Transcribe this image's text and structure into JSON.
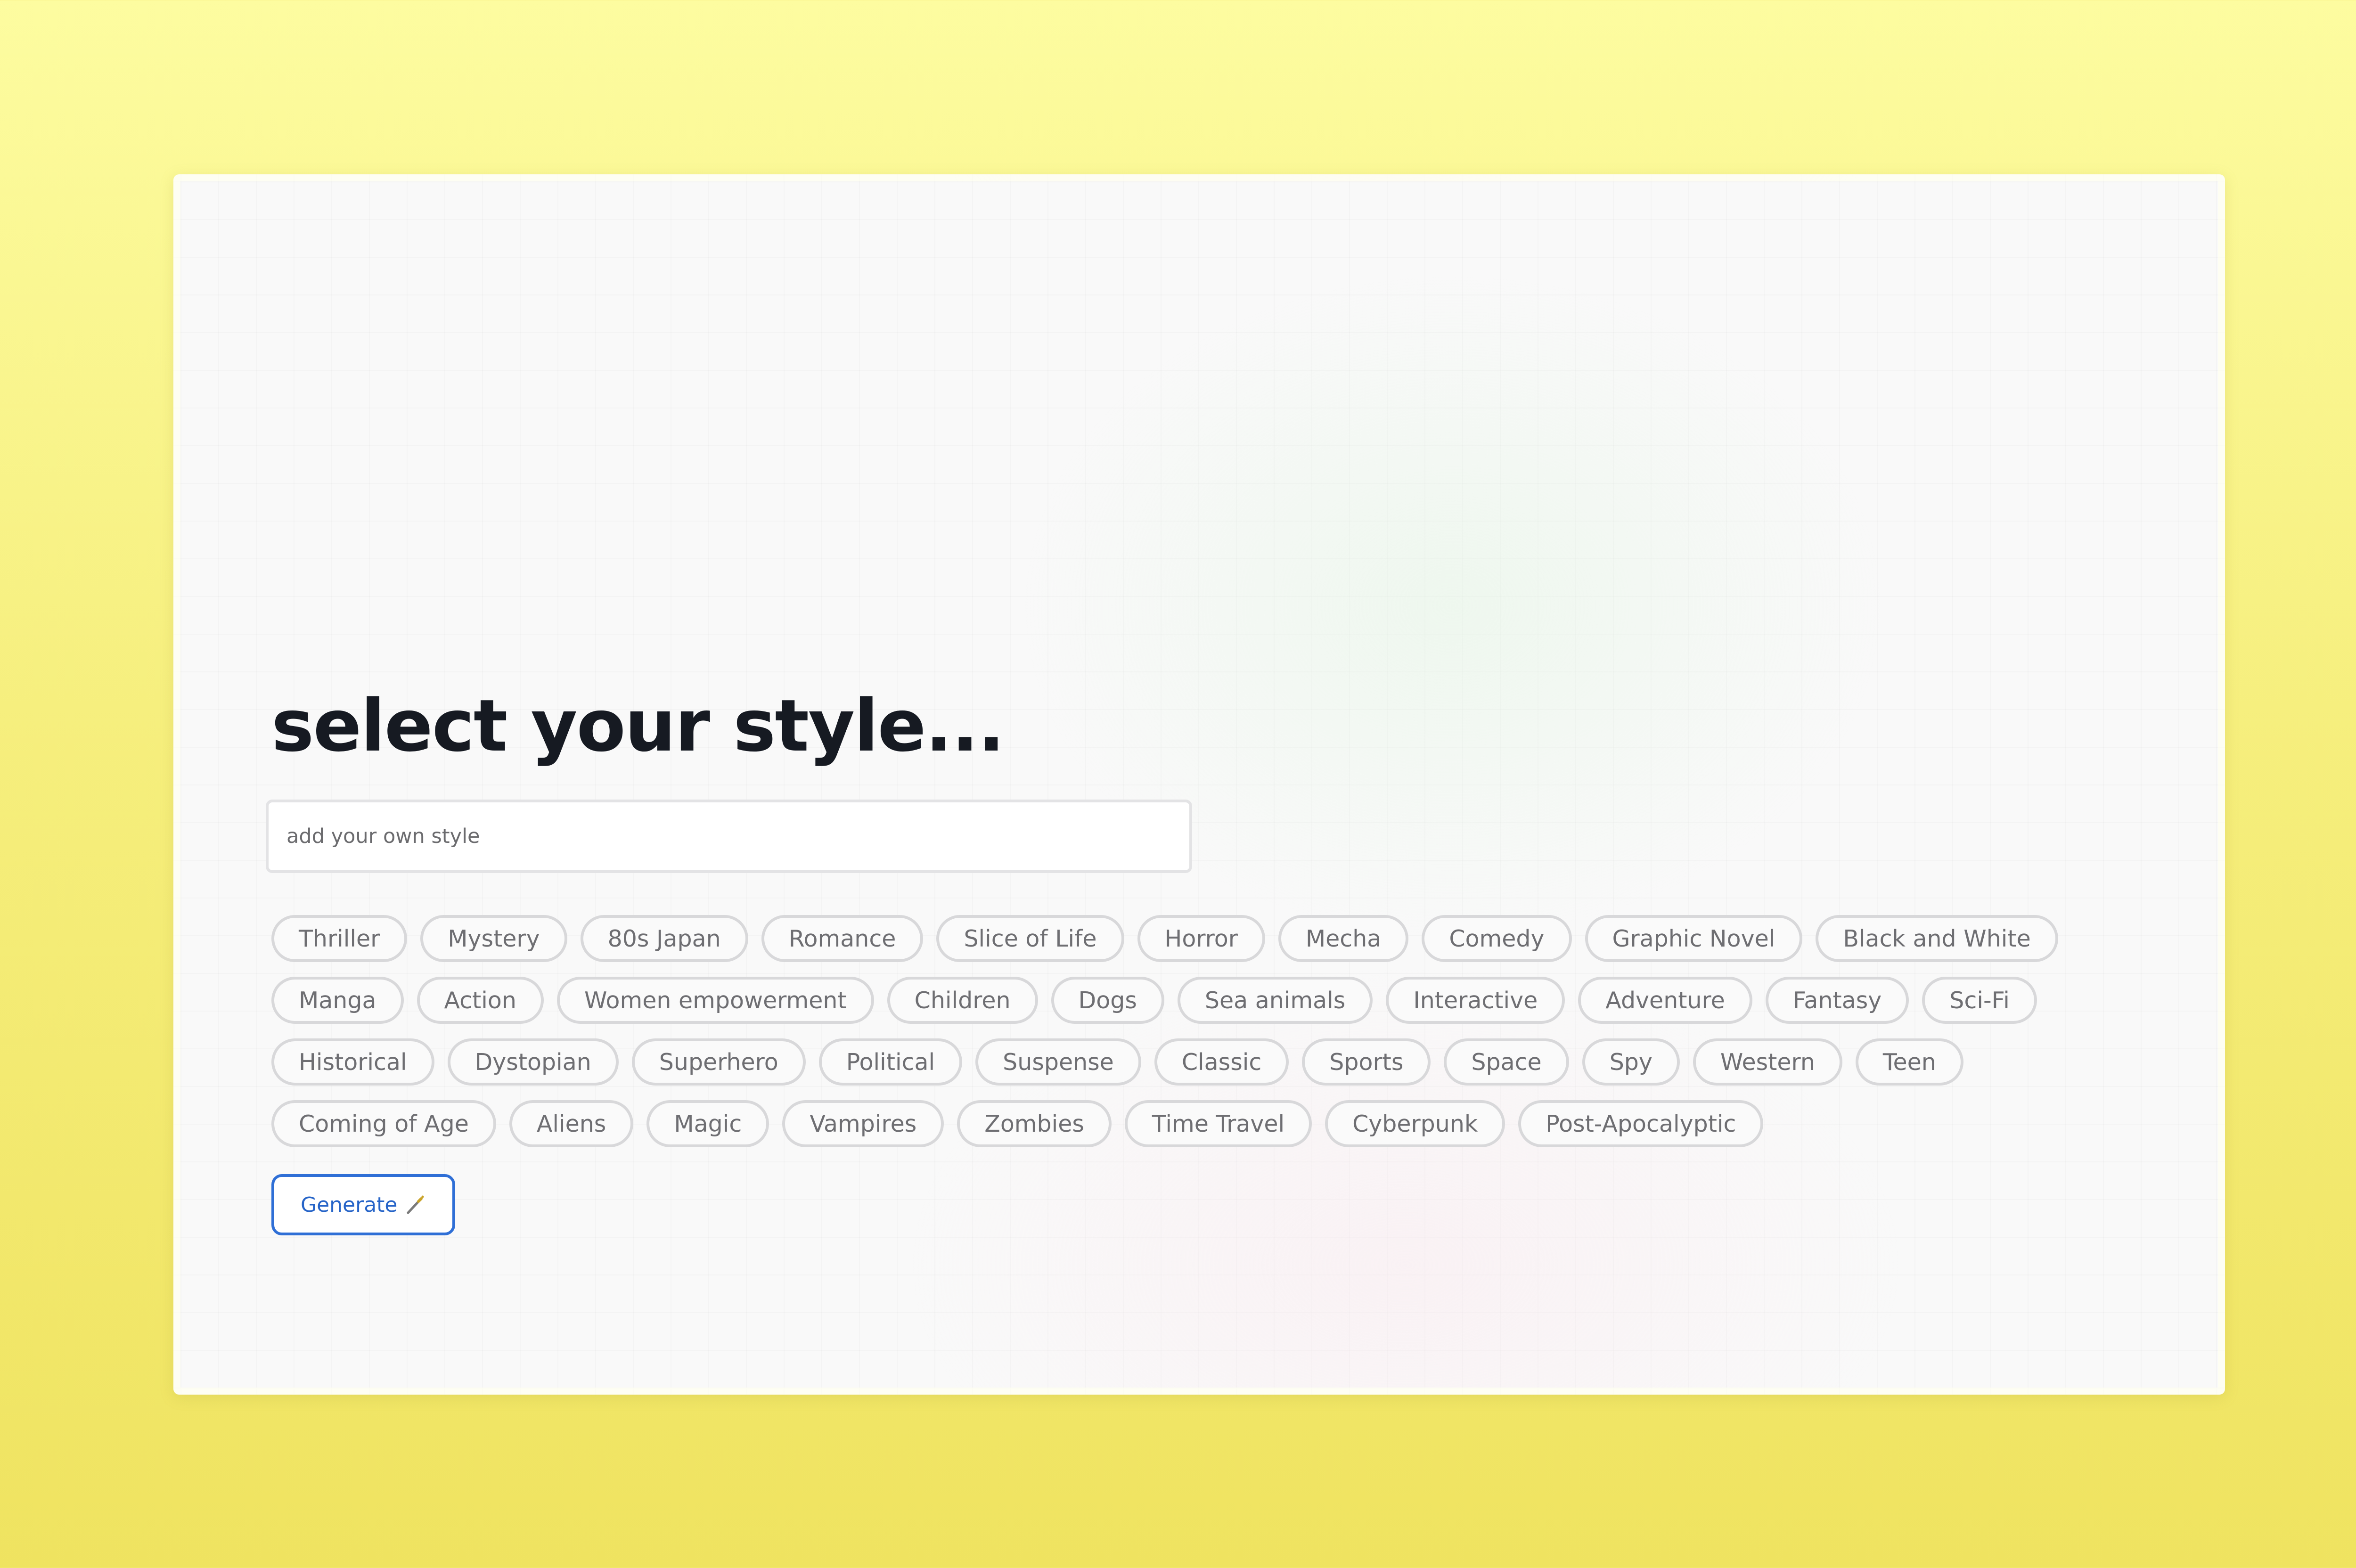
{
  "page": {
    "title": "select your style..."
  },
  "style_input": {
    "placeholder": "add your own style",
    "value": ""
  },
  "styles": {
    "rows": [
      [
        "Thriller",
        "Mystery",
        "80s Japan",
        "Romance",
        "Slice of Life",
        "Horror",
        "Mecha",
        "Comedy",
        "Graphic Novel",
        "Black and White"
      ],
      [
        "Manga",
        "Action",
        "Women empowerment",
        "Children",
        "Dogs",
        "Sea animals",
        "Interactive",
        "Adventure",
        "Fantasy",
        "Sci-Fi"
      ],
      [
        "Historical",
        "Dystopian",
        "Superhero",
        "Political",
        "Suspense",
        "Classic",
        "Sports",
        "Space",
        "Spy",
        "Western",
        "Teen"
      ],
      [
        "Coming of Age",
        "Aliens",
        "Magic",
        "Vampires",
        "Zombies",
        "Time Travel",
        "Cyberpunk",
        "Post-Apocalyptic"
      ]
    ]
  },
  "generate_button": {
    "label": "Generate",
    "icon": "magic-wand-icon"
  },
  "colors": {
    "accent": "#2f6fd6",
    "background": "#fbf9a0",
    "title": "#161a22",
    "chip_border": "#d8d8da",
    "chip_text": "#6e6e72"
  }
}
